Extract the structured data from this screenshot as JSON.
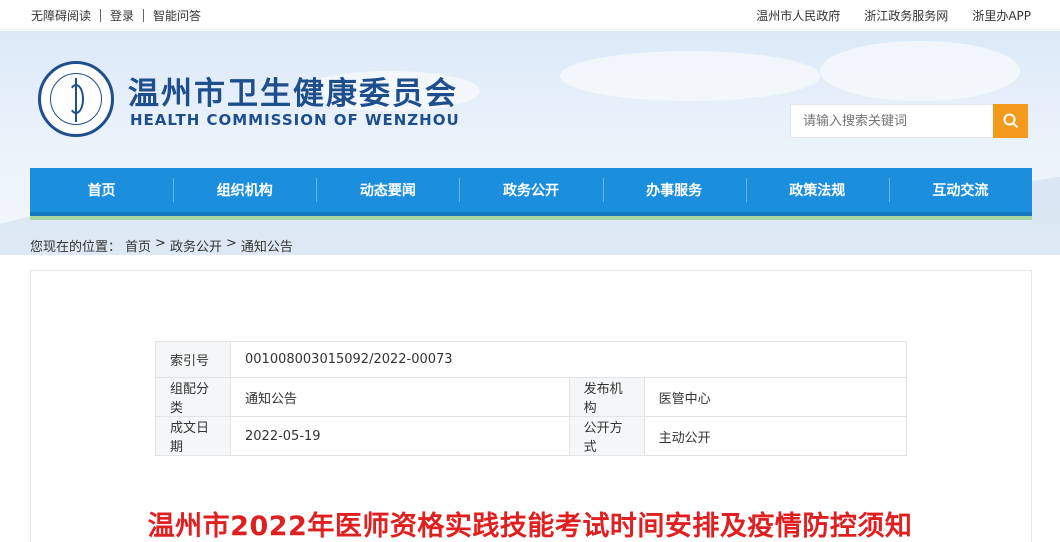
{
  "topbar": {
    "left": [
      "无障碍阅读",
      "登录",
      "智能问答"
    ],
    "right": [
      "温州市人民政府",
      "浙江政务服务网",
      "浙里办APP"
    ]
  },
  "header": {
    "title": "温州市卫生健康委员会",
    "subtitle": "HEALTH COMMISSION OF WENZHOU",
    "search_placeholder": "请输入搜索关键词",
    "search_icon": "search-icon"
  },
  "nav": [
    "首页",
    "组织机构",
    "动态要闻",
    "政务公开",
    "办事服务",
    "政策法规",
    "互动交流"
  ],
  "breadcrumb": {
    "prefix": "您现在的位置：",
    "items": [
      "首页",
      "政务公开",
      "通知公告"
    ],
    "separator": ">"
  },
  "meta": {
    "index_label": "索引号",
    "index_value": "001008003015092/2022-00073",
    "category_label": "组配分类",
    "category_value": "通知公告",
    "publisher_label": "发布机构",
    "publisher_value": "医管中心",
    "date_label": "成文日期",
    "date_value": "2022-05-19",
    "mode_label": "公开方式",
    "mode_value": "主动公开"
  },
  "article": {
    "title": "温州市2022年医师资格实践技能考试时间安排及疫情防控须知"
  },
  "colors": {
    "brand_blue": "#1e4f8c",
    "nav_blue": "#1b8fde",
    "search_orange": "#f39a1c",
    "title_red": "#e02020"
  }
}
